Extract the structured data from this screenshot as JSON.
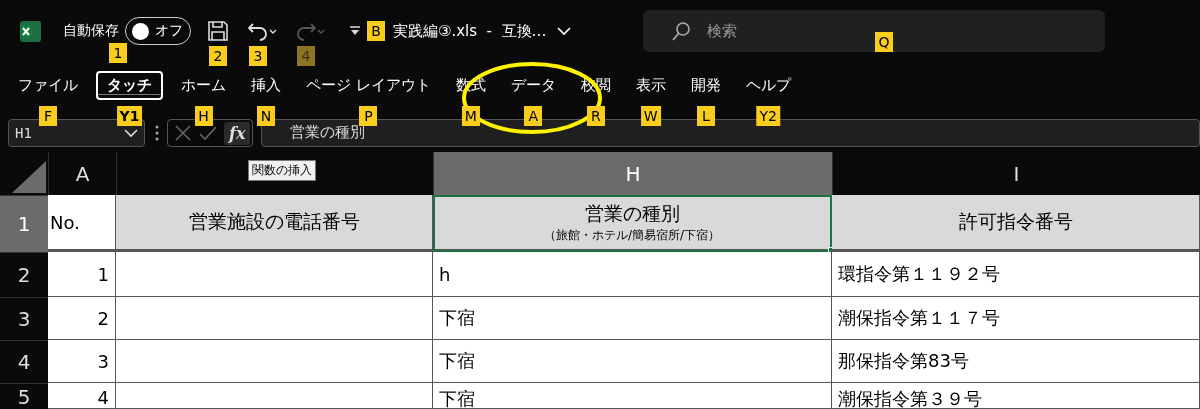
{
  "title_bar": {
    "autosave": {
      "label": "自動保存",
      "toggle_label": "オフ",
      "on": false,
      "keytip": "1"
    },
    "quick_access": [
      {
        "kind": "save",
        "keytip": "2",
        "disabled": false
      },
      {
        "kind": "undo",
        "keytip": "3",
        "disabled": false
      },
      {
        "kind": "redo",
        "keytip": "4",
        "disabled": true
      }
    ],
    "customize_keytip": "B",
    "file_title": "実践編③.xls  -  互換…",
    "search": {
      "placeholder": "検索",
      "keytip": "Q"
    }
  },
  "ribbon_tabs": [
    {
      "label": "ファイル",
      "keytip": "F",
      "selected": false
    },
    {
      "label": "タッチ",
      "keytip": "Y1",
      "selected": true
    },
    {
      "label": "ホーム",
      "keytip": "H",
      "selected": false
    },
    {
      "label": "挿入",
      "keytip": "N",
      "selected": false
    },
    {
      "label": "ページ レイアウト",
      "keytip": "P",
      "selected": false
    },
    {
      "label": "数式",
      "keytip": "M",
      "selected": false
    },
    {
      "label": "データ",
      "keytip": "A",
      "selected": false
    },
    {
      "label": "校閲",
      "keytip": "R",
      "selected": false
    },
    {
      "label": "表示",
      "keytip": "W",
      "selected": false
    },
    {
      "label": "開発",
      "keytip": "L",
      "selected": false
    },
    {
      "label": "ヘルプ",
      "keytip": "Y2",
      "selected": false
    }
  ],
  "annotation": {
    "kind": "ellipse"
  },
  "formula_bar": {
    "name_box": "H1",
    "function_button": "fx",
    "function_tooltip": "関数の挿入",
    "value": "営業の種別"
  },
  "sheet": {
    "columns": [
      {
        "label": "A",
        "selected": false
      },
      {
        "selected": false
      },
      {
        "label": "H",
        "selected": true
      },
      {
        "label": "I",
        "selected": false
      }
    ],
    "rows": [
      {
        "header": "1",
        "selected": true,
        "kind": "heading",
        "cells": [
          {
            "text": "No.",
            "active": false
          },
          {
            "text": "営業施設の電話番号",
            "active": false
          },
          {
            "text": "営業の種別",
            "sub": "（旅館・ホテル/簡易宿所/下宿）",
            "active": true
          },
          {
            "text": "許可指令番号",
            "active": false
          }
        ]
      },
      {
        "header": "2",
        "selected": false,
        "kind": "data",
        "cells": [
          {
            "text": "1",
            "active": false
          },
          {
            "active": false
          },
          {
            "text": "h",
            "active": false
          },
          {
            "text": "環指令第１１９２号",
            "active": false
          }
        ]
      },
      {
        "header": "3",
        "selected": false,
        "kind": "data",
        "cells": [
          {
            "text": "2",
            "active": false
          },
          {
            "active": false
          },
          {
            "text": "下宿",
            "active": false
          },
          {
            "text": "潮保指令第１１７号",
            "active": false
          }
        ]
      },
      {
        "header": "4",
        "selected": false,
        "kind": "data",
        "cells": [
          {
            "text": "3",
            "active": false
          },
          {
            "active": false
          },
          {
            "text": "下宿",
            "active": false
          },
          {
            "text": "那保指令第83号",
            "active": false
          }
        ]
      },
      {
        "header": "5",
        "selected": false,
        "kind": "data",
        "cells": [
          {
            "text": "4",
            "active": false
          },
          {
            "active": false
          },
          {
            "text": "下宿",
            "active": false
          },
          {
            "text": "潮保指令第３９号",
            "active": false
          }
        ]
      }
    ]
  }
}
